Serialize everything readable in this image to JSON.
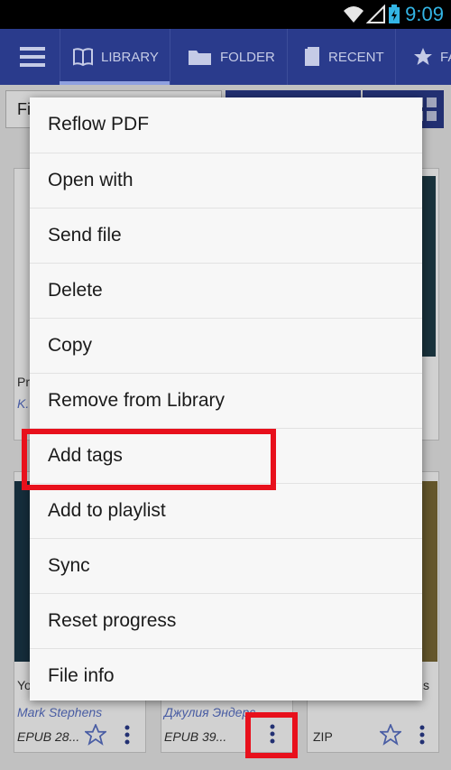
{
  "status_bar": {
    "time": "9:09",
    "icons": [
      "wifi-icon",
      "signal-icon",
      "battery-charging-icon"
    ],
    "time_color": "#33b5e5"
  },
  "tabs": [
    {
      "label": "LIBRARY",
      "icon": "book-icon",
      "active": true
    },
    {
      "label": "FOLDER",
      "icon": "folder-icon"
    },
    {
      "label": "RECENT",
      "icon": "recent-icon"
    },
    {
      "label": "FA",
      "icon": "star-icon"
    }
  ],
  "toolbar": {
    "filter_partial": "Fi"
  },
  "background_cards": [
    {
      "title_partial": "Pr",
      "author_partial": "K."
    },
    {
      "title_partial": "Yo",
      "author": "Mark Stephens",
      "format": "EPUB 28..."
    },
    {
      "author": "Джулия Эндерс",
      "format": "EPUB 39..."
    },
    {
      "title_partial": "s",
      "format": "ZIP"
    }
  ],
  "context_menu": {
    "items": [
      "Reflow PDF",
      "Open with",
      "Send file",
      "Delete",
      "Copy",
      "Remove from Library",
      "Add tags",
      "Add to playlist",
      "Sync",
      "Reset progress",
      "File info"
    ]
  },
  "colors": {
    "app_bar": "#2a3b8c",
    "highlight": "#e8101c",
    "menu_bg": "#f7f7f7"
  }
}
